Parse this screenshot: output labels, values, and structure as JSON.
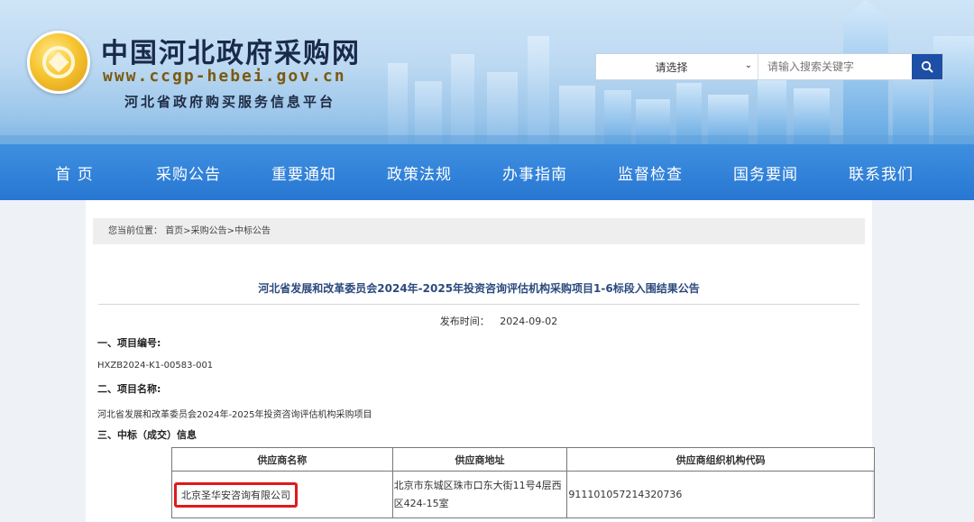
{
  "header": {
    "site_title": "中国河北政府采购网",
    "site_url": "www.ccgp-hebei.gov.cn",
    "site_subtitle": "河北省政府购买服务信息平台"
  },
  "search": {
    "select_value": "请选择",
    "placeholder": "请输入搜索关键字"
  },
  "nav": {
    "items": [
      "首 页",
      "采购公告",
      "重要通知",
      "政策法规",
      "办事指南",
      "监督检查",
      "国务要闻",
      "联系我们"
    ]
  },
  "breadcrumb": {
    "prefix": "您当前位置：",
    "path": "首页>采购公告>中标公告"
  },
  "article": {
    "title": "河北省发展和改革委员会2024年-2025年投资咨询评估机构采购项目1-6标段入围结果公告",
    "publish_label": "发布时间：",
    "publish_date": "2024-09-02",
    "sections": [
      {
        "heading": "一、项目编号:",
        "text": "HXZB2024-K1-00583-001"
      },
      {
        "heading": "二、项目名称:",
        "text": "河北省发展和改革委员会2024年-2025年投资咨询评估机构采购项目"
      },
      {
        "heading": "三、中标（成交）信息",
        "text": ""
      }
    ],
    "table": {
      "headers": [
        "供应商名称",
        "供应商地址",
        "供应商组织机构代码"
      ],
      "rows": [
        [
          "北京圣华安咨询有限公司",
          "北京市东城区珠市口东大街11号4层西区424-15室",
          "911101057214320736"
        ]
      ]
    }
  },
  "colors": {
    "nav_bg": "#2777d3",
    "title_blue": "#2c4a7e",
    "highlight_red": "#e0191b",
    "search_button": "#1e4fa6"
  }
}
